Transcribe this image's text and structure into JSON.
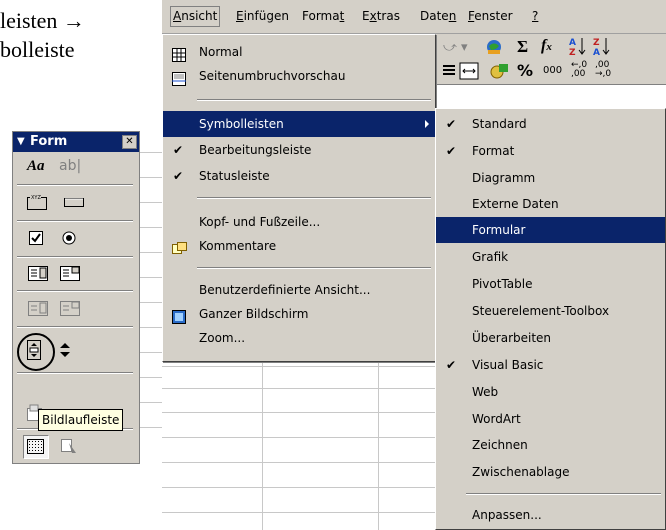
{
  "document": {
    "line1": "leisten →",
    "line2": "bolleiste"
  },
  "menubar": {
    "items": [
      {
        "label": "Ansicht",
        "mnemonic_index": 0
      },
      {
        "label": "Einfügen"
      },
      {
        "label": "Format"
      },
      {
        "label": "Extras"
      },
      {
        "label": "Daten"
      },
      {
        "label": "Fenster"
      },
      {
        "label": "?"
      }
    ]
  },
  "ansicht_menu": {
    "items": [
      {
        "label": "Normal",
        "icon": "normal-view-icon"
      },
      {
        "label": "Seitenumbruchvorschau",
        "icon": "page-break-preview-icon"
      },
      {
        "label": "Symbolleisten",
        "submenu": true,
        "selected": true
      },
      {
        "label": "Bearbeitungsleiste",
        "checked": true
      },
      {
        "label": "Statusleiste",
        "checked": true
      },
      {
        "label": "Kopf- und Fußzeile..."
      },
      {
        "label": "Kommentare",
        "icon": "comments-icon"
      },
      {
        "label": "Benutzerdefinierte Ansicht..."
      },
      {
        "label": "Ganzer Bildschirm",
        "icon": "full-screen-icon"
      },
      {
        "label": "Zoom..."
      }
    ]
  },
  "symbolleisten_menu": {
    "items": [
      {
        "label": "Standard",
        "checked": true
      },
      {
        "label": "Format",
        "checked": true
      },
      {
        "label": "Diagramm"
      },
      {
        "label": "Externe Daten"
      },
      {
        "label": "Formular",
        "selected": true
      },
      {
        "label": "Grafik"
      },
      {
        "label": "PivotTable"
      },
      {
        "label": "Steuerelement-Toolbox"
      },
      {
        "label": "Überarbeiten"
      },
      {
        "label": "Visual Basic",
        "checked": true
      },
      {
        "label": "Web"
      },
      {
        "label": "WordArt"
      },
      {
        "label": "Zeichnen"
      },
      {
        "label": "Zwischenablage"
      },
      {
        "label": "Anpassen..."
      }
    ]
  },
  "toolbar": {
    "sigma": "Σ",
    "fx": "fx",
    "percent": "%",
    "thousands": "000",
    "dec_inc": ",0\n,00",
    "dec_dec": ",00\n,0"
  },
  "palette": {
    "title": "Form",
    "label_button": "Aa",
    "editbox_button": "ab|",
    "groupbox_caption": "XYZ",
    "tooltip": "Bildlaufleiste"
  },
  "colors": {
    "face": "#d4d0c8",
    "highlight": "#0a246a",
    "tooltip_bg": "#ffffe1"
  }
}
